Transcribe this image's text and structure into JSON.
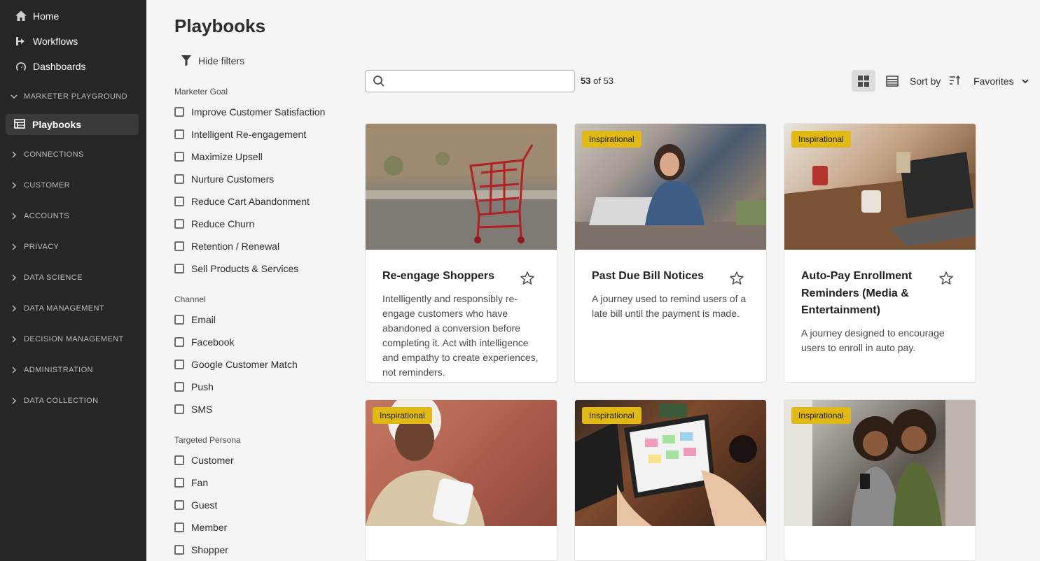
{
  "sidebar": {
    "top_items": [
      {
        "label": "Home",
        "icon": "home-icon"
      },
      {
        "label": "Workflows",
        "icon": "workflow-icon"
      },
      {
        "label": "Dashboards",
        "icon": "gauge-icon"
      }
    ],
    "section_open": "MARKETER PLAYGROUND",
    "active_item": "Playbooks",
    "sections": [
      "CONNECTIONS",
      "CUSTOMER",
      "ACCOUNTS",
      "PRIVACY",
      "DATA SCIENCE",
      "DATA MANAGEMENT",
      "DECISION MANAGEMENT",
      "ADMINISTRATION",
      "DATA COLLECTION"
    ]
  },
  "page": {
    "title": "Playbooks",
    "hide_filters": "Hide filters"
  },
  "filters": {
    "groups": [
      {
        "title": "Marketer Goal",
        "items": [
          "Improve Customer Satisfaction",
          "Intelligent Re-engagement",
          "Maximize Upsell",
          "Nurture Customers",
          "Reduce Cart Abandonment",
          "Reduce Churn",
          "Retention / Renewal",
          "Sell Products & Services"
        ]
      },
      {
        "title": "Channel",
        "items": [
          "Email",
          "Facebook",
          "Google Customer Match",
          "Push",
          "SMS"
        ]
      },
      {
        "title": "Targeted Persona",
        "items": [
          "Customer",
          "Fan",
          "Guest",
          "Member",
          "Shopper"
        ]
      }
    ]
  },
  "toolbar": {
    "search_placeholder": "",
    "count_shown": "53",
    "count_of": "of 53",
    "sort_label": "Sort by",
    "sort_value": "Favorites"
  },
  "cards": [
    {
      "badge": "",
      "title": "Re-engage Shoppers",
      "description": "Intelligently and responsibly re-engage customers who have abandoned a conversion before completing it. Act with intelligence and empathy to create experiences, not reminders."
    },
    {
      "badge": "Inspirational",
      "title": "Past Due Bill Notices",
      "description": "A journey used to remind users of a late bill until the payment is made."
    },
    {
      "badge": "Inspirational",
      "title": "Auto-Pay Enrollment Reminders (Media & Entertainment)",
      "description": "A journey designed to encourage users to enroll in auto pay."
    },
    {
      "badge": "Inspirational",
      "title": "",
      "description": ""
    },
    {
      "badge": "Inspirational",
      "title": "",
      "description": ""
    },
    {
      "badge": "Inspirational",
      "title": "",
      "description": ""
    }
  ]
}
